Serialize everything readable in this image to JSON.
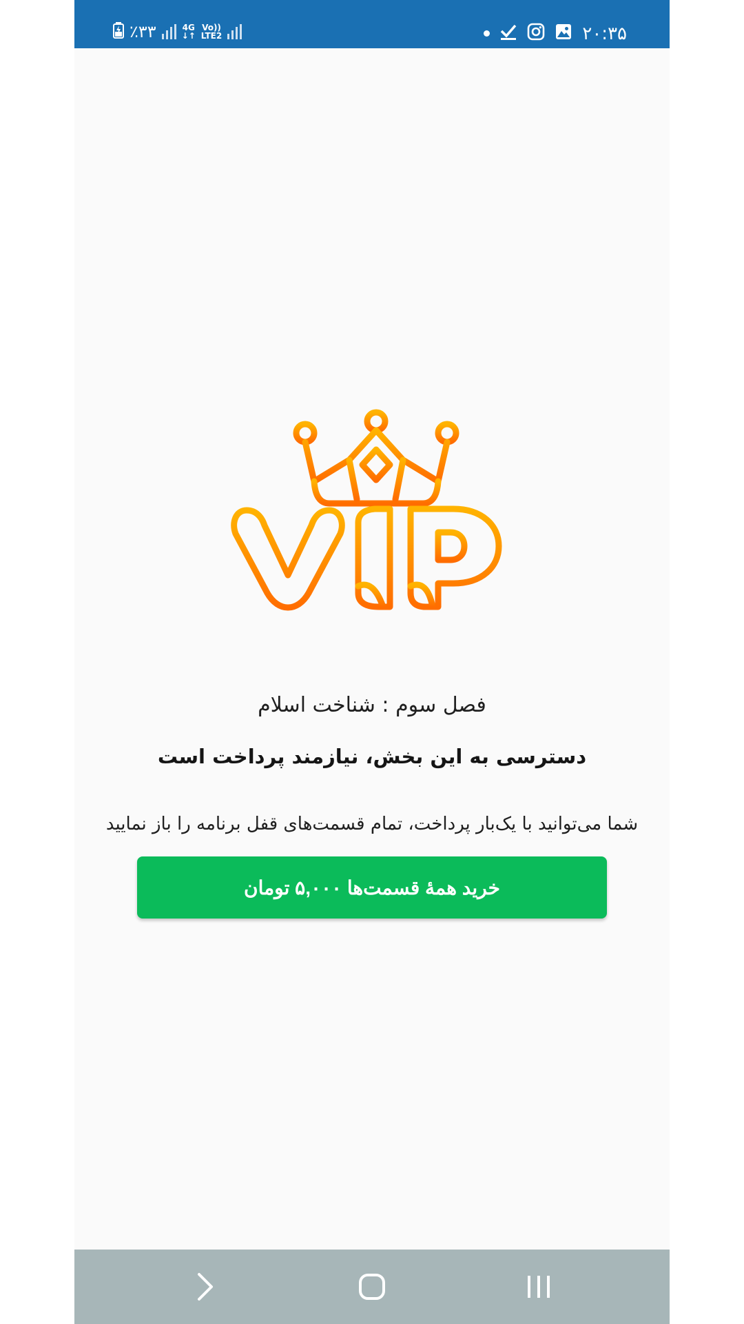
{
  "status_bar": {
    "battery": "٪۳۳",
    "network": {
      "top": "4G",
      "bottom": "LTE2",
      "volte": "Vo))"
    },
    "time": "۲۰:۳۵",
    "icons": [
      "battery-icon",
      "signal-icon",
      "notification-dot-icon",
      "check-icon",
      "instagram-icon",
      "gallery-icon"
    ]
  },
  "main": {
    "logo": "VIP",
    "chapter_title": "فصل سوم : شناخت اسلام",
    "headline": "دسترسی به این بخش، نیازمند پرداخت است",
    "description": "شما می‌توانید با یک‌بار پرداخت، تمام قسمت‌های قفل برنامه را باز نمایید",
    "buy_button_label": "خرید همهٔ قسمت‌ها ۵,۰۰۰ تومان"
  },
  "nav_bar": {
    "buttons": [
      "back-icon",
      "home-icon",
      "recent-apps-icon"
    ]
  },
  "colors": {
    "status_bar": "#1a70b3",
    "button": "#0bbb5a",
    "nav_bar": "#a7b6b8",
    "logo_top": "#ffb300",
    "logo_bottom": "#ff6d00"
  }
}
